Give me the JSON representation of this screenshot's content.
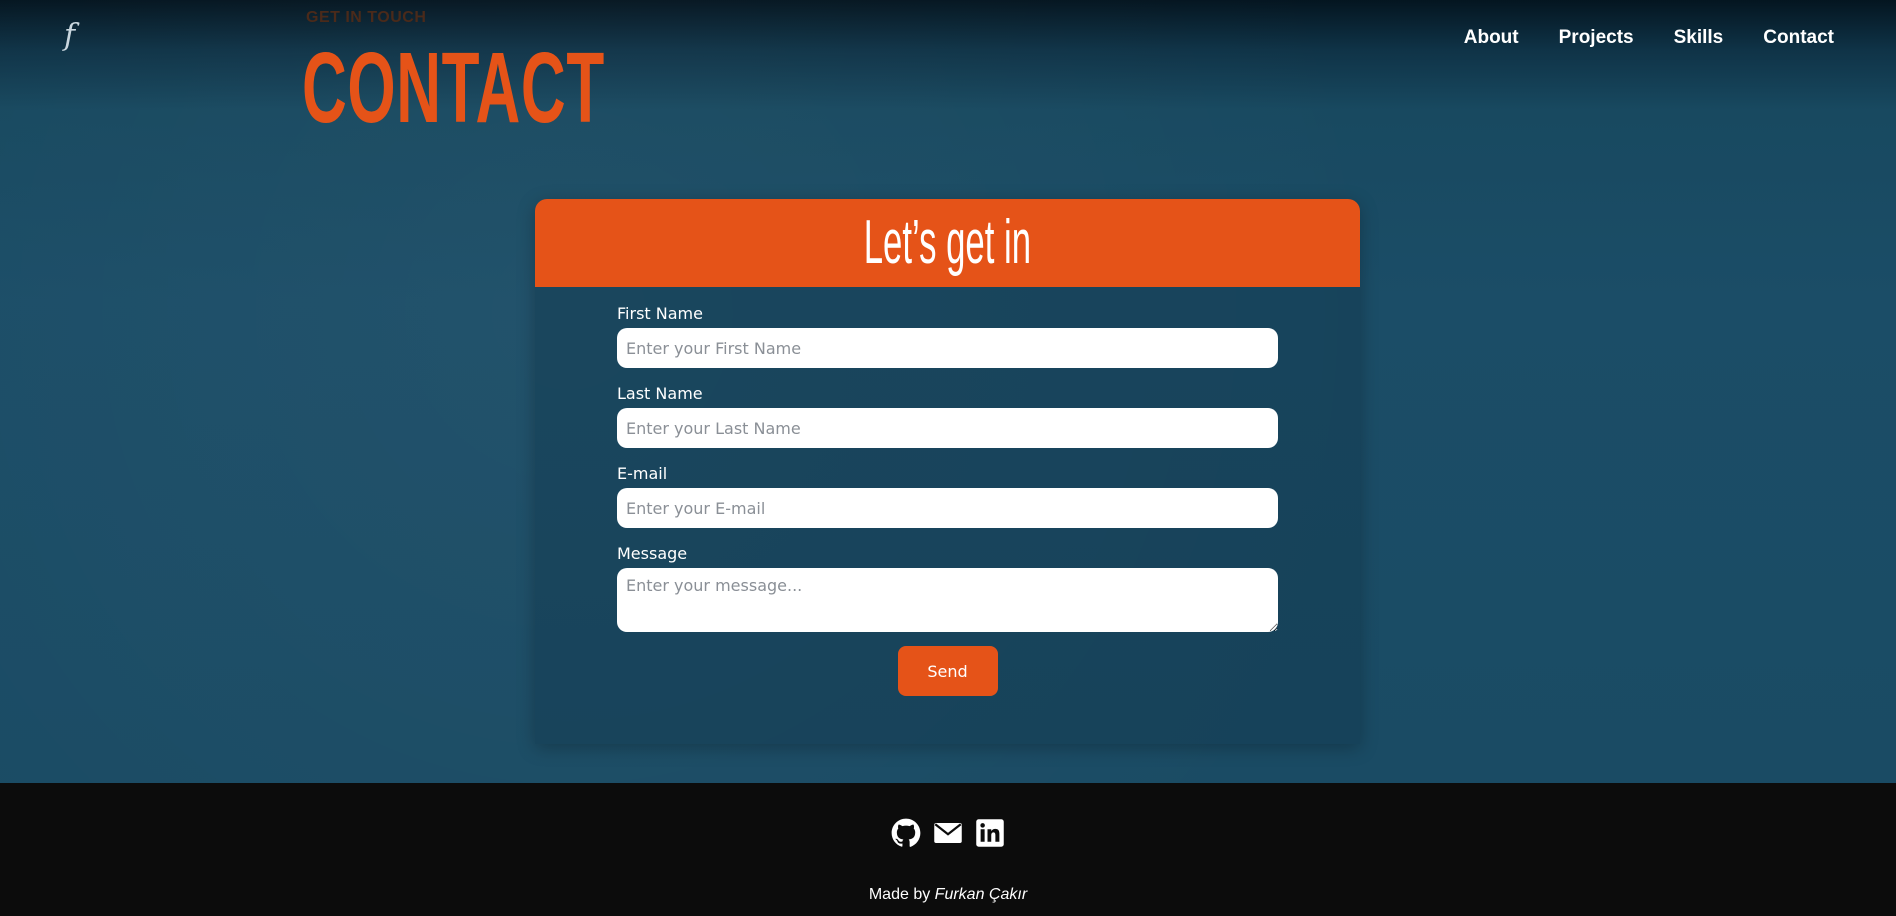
{
  "header": {
    "logo_glyph": "f",
    "nav": [
      {
        "label": "About"
      },
      {
        "label": "Projects"
      },
      {
        "label": "Skills"
      },
      {
        "label": "Contact"
      }
    ]
  },
  "hero": {
    "eyebrow": "GET IN TOUCH",
    "title": "CONTACT"
  },
  "form": {
    "heading": "Let’s get in",
    "first_name": {
      "label": "First Name",
      "placeholder": "Enter your First Name",
      "value": ""
    },
    "last_name": {
      "label": "Last Name",
      "placeholder": "Enter your Last Name",
      "value": ""
    },
    "email": {
      "label": "E-mail",
      "placeholder": "Enter your E-mail",
      "value": ""
    },
    "message": {
      "label": "Message",
      "placeholder": "Enter your message...",
      "value": ""
    },
    "submit_label": "Send"
  },
  "footer": {
    "socials": [
      {
        "icon": "github-icon"
      },
      {
        "icon": "mail-icon"
      },
      {
        "icon": "linkedin-icon"
      }
    ],
    "credit_prefix": "Made by",
    "credit_name": "Furkan Çakır"
  },
  "colors": {
    "accent": "#e55318",
    "background": "#1a4b64",
    "footer": "#0c0c0c",
    "text": "#ffffff"
  }
}
